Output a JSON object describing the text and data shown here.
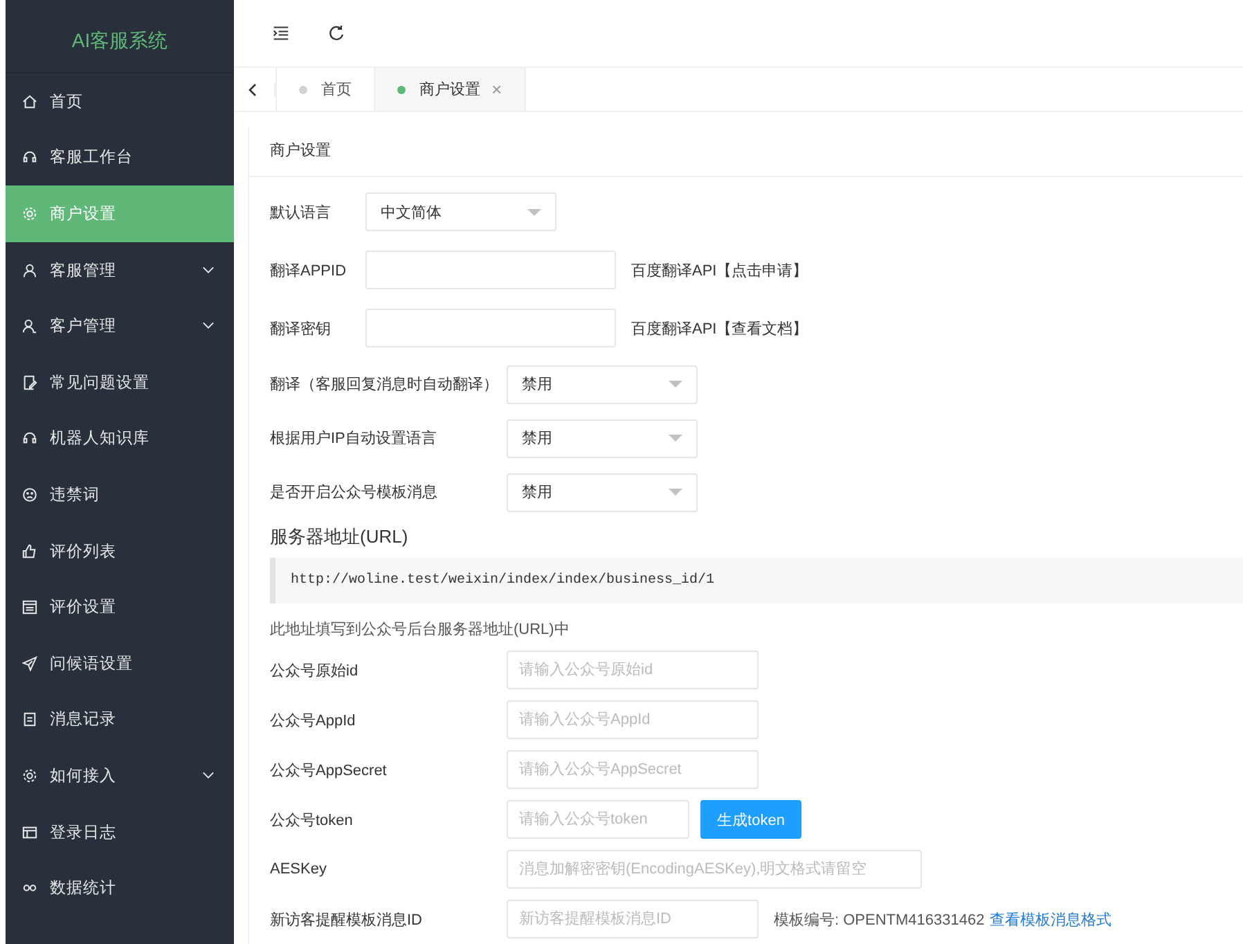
{
  "sidebar": {
    "logo": "AI客服系统",
    "items": [
      {
        "label": "首页",
        "selected": false,
        "expandable": false
      },
      {
        "label": "客服工作台",
        "selected": false,
        "expandable": false
      },
      {
        "label": "商户设置",
        "selected": true,
        "expandable": false
      },
      {
        "label": "客服管理",
        "selected": false,
        "expandable": true
      },
      {
        "label": "客户管理",
        "selected": false,
        "expandable": true
      },
      {
        "label": "常见问题设置",
        "selected": false,
        "expandable": false
      },
      {
        "label": "机器人知识库",
        "selected": false,
        "expandable": false
      },
      {
        "label": "违禁词",
        "selected": false,
        "expandable": false
      },
      {
        "label": "评价列表",
        "selected": false,
        "expandable": false
      },
      {
        "label": "评价设置",
        "selected": false,
        "expandable": false
      },
      {
        "label": "问候语设置",
        "selected": false,
        "expandable": false
      },
      {
        "label": "消息记录",
        "selected": false,
        "expandable": false
      },
      {
        "label": "如何接入",
        "selected": false,
        "expandable": true
      },
      {
        "label": "登录日志",
        "selected": false,
        "expandable": false
      },
      {
        "label": "数据统计",
        "selected": false,
        "expandable": false
      }
    ]
  },
  "tabs": [
    {
      "label": "首页",
      "selected": false,
      "closable": false
    },
    {
      "label": "商户设置",
      "selected": true,
      "closable": true
    }
  ],
  "tab_close": "×",
  "card_title": "商户设置",
  "basic_rows": [
    {
      "kind": "select",
      "label": "默认语言",
      "value": "中文简体"
    },
    {
      "kind": "input",
      "label": "翻译APPID",
      "note": "百度翻译API【点击申请】"
    },
    {
      "kind": "input",
      "label": "翻译密钥",
      "note": "百度翻译API【查看文档】"
    }
  ],
  "option_rows": [
    {
      "label": "翻译（客服回复消息时自动翻译）",
      "value": "禁用"
    },
    {
      "label": "根据用户IP自动设置语言",
      "value": "禁用"
    },
    {
      "label": "是否开启公众号模板消息",
      "value": "禁用"
    }
  ],
  "server": {
    "title": "服务器地址(URL)",
    "url": "http://woline.test/weixin/index/index/business_id/1",
    "hint": "此地址填写到公众号后台服务器地址(URL)中"
  },
  "wechat_rows": [
    {
      "kind": "input",
      "label": "公众号原始id",
      "placeholder": "请输入公众号原始id"
    },
    {
      "kind": "input",
      "label": "公众号AppId",
      "placeholder": "请输入公众号AppId"
    },
    {
      "kind": "input",
      "label": "公众号AppSecret",
      "placeholder": "请输入公众号AppSecret"
    },
    {
      "kind": "button",
      "label": "公众号token",
      "placeholder": "请输入公众号token",
      "button": "生成token"
    },
    {
      "kind": "wide",
      "label": "AESKey",
      "placeholder": "消息加解密密钥(EncodingAESKey),明文格式请留空"
    },
    {
      "kind": "note",
      "label": "新访客提醒模板消息ID",
      "placeholder": "新访客提醒模板消息ID",
      "note": "模板编号: OPENTM416331462",
      "link": "查看模板消息格式"
    }
  ]
}
